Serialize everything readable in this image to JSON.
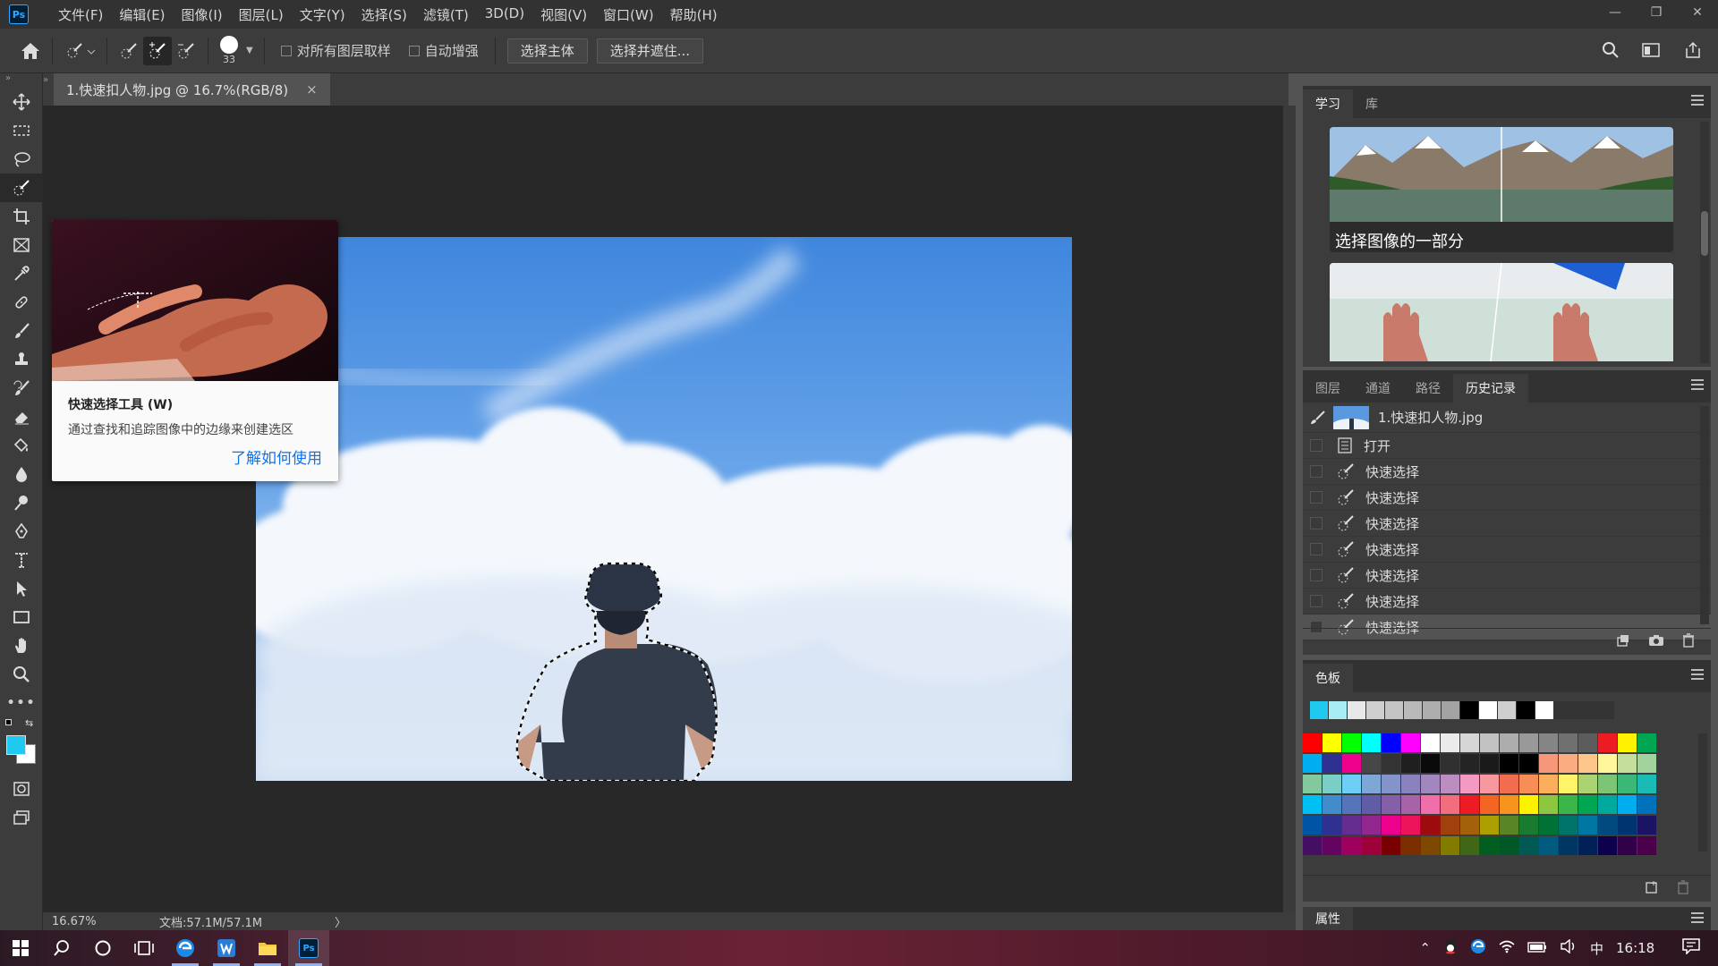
{
  "app": {
    "logo_text": "Ps",
    "menu": [
      "文件(F)",
      "编辑(E)",
      "图像(I)",
      "图层(L)",
      "文字(Y)",
      "选择(S)",
      "滤镜(T)",
      "3D(D)",
      "视图(V)",
      "窗口(W)",
      "帮助(H)"
    ]
  },
  "options_bar": {
    "brush_size": "33",
    "sample_all_layers_label": "对所有图层取样",
    "sample_all_layers_checked": false,
    "auto_enhance_label": "自动增强",
    "auto_enhance_checked": false,
    "select_subject_label": "选择主体",
    "select_mask_label": "选择并遮住..."
  },
  "document": {
    "tab_title": "1.快速扣人物.jpg @ 16.7%(RGB/8)",
    "close_glyph": "×"
  },
  "status": {
    "zoom": "16.67%",
    "doc_size": "文档:57.1M/57.1M",
    "arrow": "〉"
  },
  "tooltip": {
    "title": "快速选择工具 (W)",
    "description": "通过查找和追踪图像中的边缘来创建选区",
    "link": "了解如何使用"
  },
  "learn_panel": {
    "tabs": [
      "学习",
      "库"
    ],
    "card1_title": "选择图像的一部分"
  },
  "history_panel": {
    "tabs": [
      "图层",
      "通道",
      "路径",
      "历史记录"
    ],
    "snapshot": "1.快速扣人物.jpg",
    "items": [
      "打开",
      "快速选择",
      "快速选择",
      "快速选择",
      "快速选择",
      "快速选择",
      "快速选择",
      "快速选择"
    ]
  },
  "swatches_panel": {
    "tab": "色板",
    "recent": [
      "#1fc9f0",
      "#a8ecf6",
      "#e8e8e8",
      "#cfcfcf",
      "#c4c4c4",
      "#b9b9b9",
      "#aeaeae",
      "#a3a3a3",
      "#000000",
      "#ffffff",
      "#cfcfcf",
      "#000000",
      "#ffffff"
    ],
    "grid": [
      [
        "#ff0000",
        "#ffff00",
        "#00ff00",
        "#00ffff",
        "#0000ff",
        "#ff00ff",
        "#ffffff",
        "#ebebeb",
        "#d6d6d6",
        "#c2c2c2",
        "#adadad",
        "#999999",
        "#858585",
        "#707070",
        "#5c5c5c",
        "#ed1c24",
        "#fff200",
        "#00a651"
      ],
      [
        "#00aeef",
        "#2e3192",
        "#ec008c",
        "#474747",
        "#333333",
        "#1f1f1f",
        "#0a0a0a",
        "#303030",
        "#242424",
        "#1a1a1a",
        "#000000",
        "#000000",
        "#f7977a",
        "#f9ad81",
        "#fdc68a",
        "#fff79a",
        "#c4df9b",
        "#a3d39c"
      ],
      [
        "#82ca9d",
        "#7bcdc8",
        "#6ecff6",
        "#7ea7d8",
        "#8493ca",
        "#8882be",
        "#a187be",
        "#bc8dbf",
        "#f49ac2",
        "#f6989d",
        "#f26c4f",
        "#f68e55",
        "#fbaf5c",
        "#fff467",
        "#acd372",
        "#7cc576",
        "#3bb878",
        "#1abbb4"
      ],
      [
        "#00bff3",
        "#438ccb",
        "#5574b9",
        "#605ca8",
        "#855fa8",
        "#a763a8",
        "#f06ea9",
        "#f26d7d",
        "#ed1c24",
        "#f26522",
        "#f7941d",
        "#fff200",
        "#8dc63f",
        "#39b54a",
        "#00a651",
        "#00a99d",
        "#00aeef",
        "#0072bc"
      ],
      [
        "#0054a6",
        "#2e3192",
        "#662d91",
        "#92278f",
        "#ec008c",
        "#ed145b",
        "#9e0b0f",
        "#a0410d",
        "#a36209",
        "#aba000",
        "#598527",
        "#197b30",
        "#007236",
        "#00746b",
        "#0076a3",
        "#004a80",
        "#003471",
        "#1b1464"
      ],
      [
        "#440e62",
        "#630460",
        "#9e005d",
        "#9e0039",
        "#790000",
        "#7b2e00",
        "#7d4900",
        "#827b00",
        "#406618",
        "#005e20",
        "#005826",
        "#005952",
        "#005b7f",
        "#003663",
        "#002157",
        "#0d004c",
        "#32004b",
        "#4b0049"
      ]
    ]
  },
  "properties_panel": {
    "tab": "属性"
  },
  "taskbar": {
    "clock": "16:18",
    "ime": "中"
  },
  "colors": {
    "accent": "#31a8ff",
    "foreground_color": "#1fc9f0",
    "background_color": "#ffffff",
    "link": "#1473e6"
  }
}
